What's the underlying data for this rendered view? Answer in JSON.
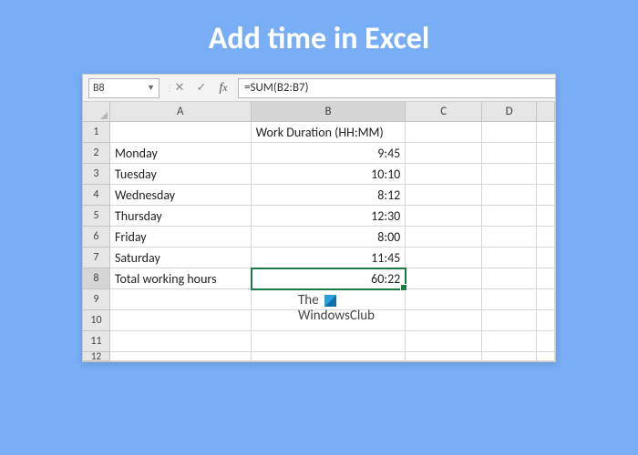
{
  "title": "Add time in Excel",
  "formula_bar": {
    "name_box": "B8",
    "formula": "=SUM(B2:B7)"
  },
  "columns": [
    "A",
    "B",
    "C",
    "D",
    ""
  ],
  "row_numbers": [
    "1",
    "2",
    "3",
    "4",
    "5",
    "6",
    "7",
    "8",
    "9",
    "10",
    "11",
    "12"
  ],
  "cells": {
    "B1": "Work Duration (HH:MM)",
    "A2": "Monday",
    "B2": "9:45",
    "A3": "Tuesday",
    "B3": "10:10",
    "A4": "Wednesday",
    "B4": "8:12",
    "A5": "Thursday",
    "B5": "12:30",
    "A6": "Friday",
    "B6": "8:00",
    "A7": "Saturday",
    "B7": "11:45",
    "A8": "Total working hours",
    "B8": "60:22"
  },
  "watermark": {
    "line1": "The",
    "line2": "WindowsClub"
  }
}
